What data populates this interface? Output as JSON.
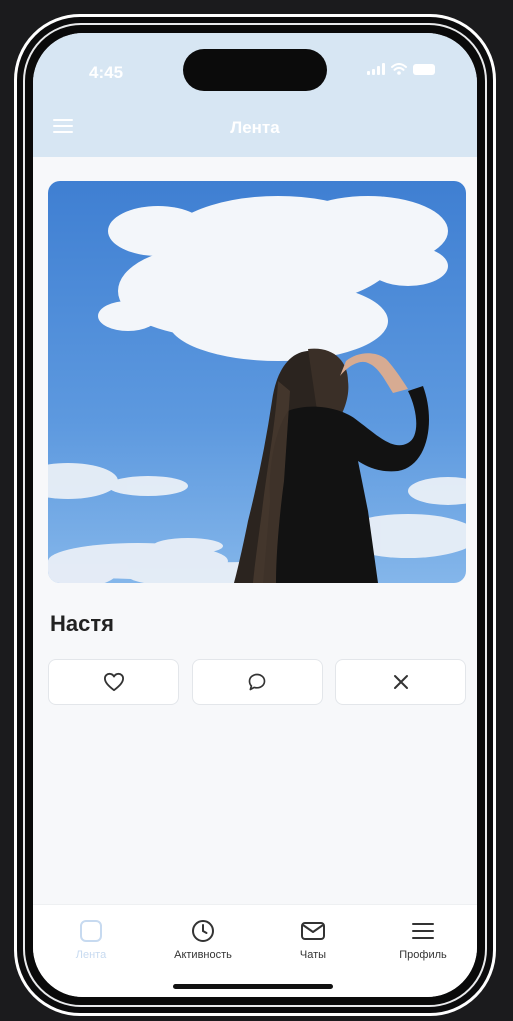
{
  "status_bar": {
    "time": "4:45"
  },
  "header": {
    "title": "Лента",
    "menu_icon": "hamburger-menu-icon"
  },
  "post": {
    "photo_icon": "photo-sky-person",
    "name": "Настя"
  },
  "actions": [
    {
      "icon": "heart-icon"
    },
    {
      "icon": "comment-icon"
    },
    {
      "icon": "close-icon"
    }
  ],
  "tabbar": {
    "items": [
      {
        "label": "Лента",
        "icon": "feed-square-icon",
        "active": true
      },
      {
        "label": "Активность",
        "icon": "clock-icon",
        "active": false
      },
      {
        "label": "Чаты",
        "icon": "mail-icon",
        "active": false
      },
      {
        "label": "Профиль",
        "icon": "menu-lines-icon",
        "active": false
      }
    ]
  },
  "colors": {
    "header_bg": "#d7e6f3",
    "screen_bg": "#f7f8fa",
    "active_tab": "#c7daf0"
  }
}
